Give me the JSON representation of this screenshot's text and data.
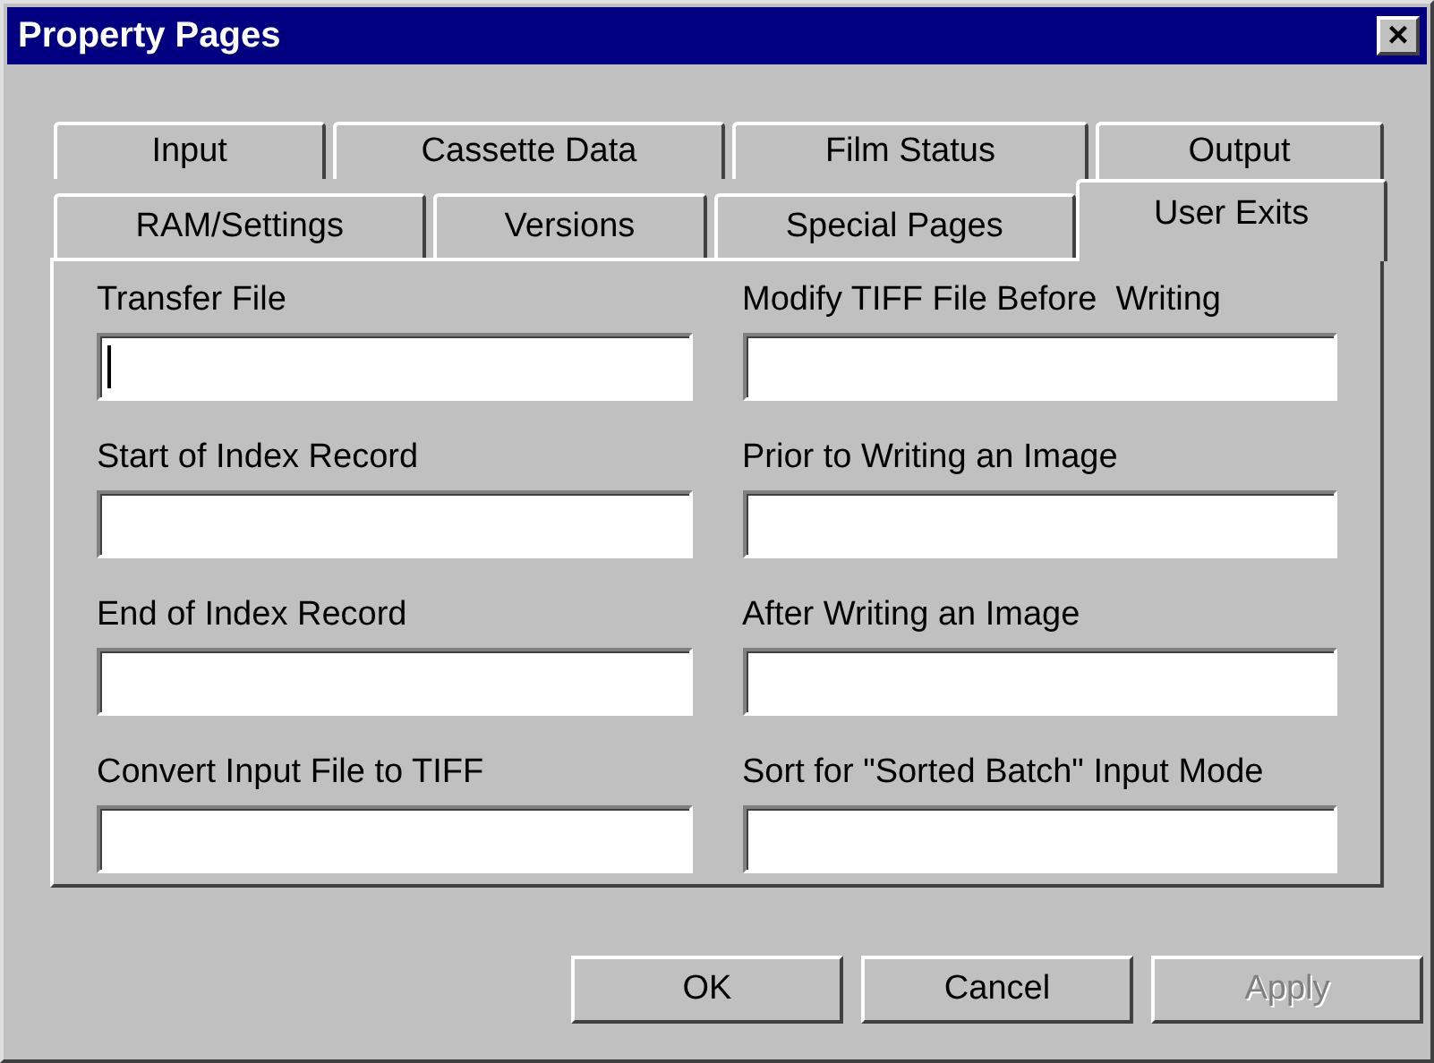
{
  "window": {
    "title": "Property Pages",
    "close": "×"
  },
  "tab_rows": [
    [
      {
        "label": "Input",
        "selected": false
      },
      {
        "label": "Cassette Data",
        "selected": false
      },
      {
        "label": "Film Status",
        "selected": false
      },
      {
        "label": "Output",
        "selected": false
      }
    ],
    [
      {
        "label": "RAM/Settings",
        "selected": false
      },
      {
        "label": "Versions",
        "selected": false
      },
      {
        "label": "Special Pages",
        "selected": false
      },
      {
        "label": "User Exits",
        "selected": true
      }
    ]
  ],
  "fields": [
    {
      "label": "Transfer File",
      "focused": true
    },
    {
      "label": "Modify TIFF File Before  Writing",
      "focused": false
    },
    {
      "label": "Start of Index Record",
      "focused": false
    },
    {
      "label": "Prior to Writing an Image",
      "focused": false
    },
    {
      "label": "End of Index Record",
      "focused": false
    },
    {
      "label": "After Writing an Image",
      "focused": false
    },
    {
      "label": "Convert Input File to TIFF",
      "focused": false
    },
    {
      "label": "Sort for \"Sorted Batch\" Input Mode",
      "focused": false
    }
  ],
  "buttons": [
    {
      "label": "OK",
      "disabled": false
    },
    {
      "label": "Cancel",
      "disabled": false
    },
    {
      "label": "Apply",
      "disabled": true
    }
  ]
}
